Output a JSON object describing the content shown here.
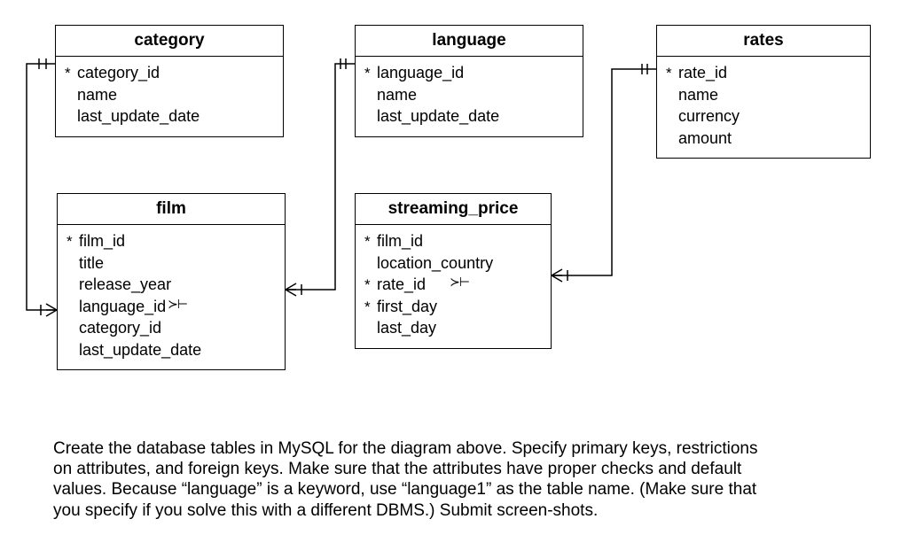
{
  "entities": {
    "category": {
      "title": "category",
      "attrs": [
        {
          "pk": true,
          "name": "category_id"
        },
        {
          "pk": false,
          "name": "name"
        },
        {
          "pk": false,
          "name": "last_update_date"
        }
      ]
    },
    "language": {
      "title": "language",
      "attrs": [
        {
          "pk": true,
          "name": "language_id"
        },
        {
          "pk": false,
          "name": "name"
        },
        {
          "pk": false,
          "name": "last_update_date"
        }
      ]
    },
    "rates": {
      "title": "rates",
      "attrs": [
        {
          "pk": true,
          "name": "rate_id"
        },
        {
          "pk": false,
          "name": "name"
        },
        {
          "pk": false,
          "name": "currency"
        },
        {
          "pk": false,
          "name": "amount"
        }
      ]
    },
    "film": {
      "title": "film",
      "attrs": [
        {
          "pk": true,
          "name": "film_id"
        },
        {
          "pk": false,
          "name": "title"
        },
        {
          "pk": false,
          "name": "release_year"
        },
        {
          "pk": false,
          "name": "language_id"
        },
        {
          "pk": false,
          "name": "category_id"
        },
        {
          "pk": false,
          "name": "last_update_date"
        }
      ]
    },
    "streaming_price": {
      "title": "streaming_price",
      "attrs": [
        {
          "pk": true,
          "name": "film_id"
        },
        {
          "pk": false,
          "name": "location_country"
        },
        {
          "pk": true,
          "name": "rate_id"
        },
        {
          "pk": true,
          "name": "first_day"
        },
        {
          "pk": false,
          "name": "last_day"
        }
      ]
    }
  },
  "fk_glyphs": {
    "film_language": "≻⊢",
    "film_category": "≻⊧",
    "sp_rate": "≻⊢",
    "cat_end_one": "⊣⊢",
    "lang_end_one": "⊣⊢",
    "rates_end_one": "⊣⊢"
  },
  "instructions": {
    "line1": "Create the database tables in MySQL for the diagram above.  Specify primary keys, restrictions",
    "line2": "on attributes, and foreign keys.  Make sure that the attributes have proper checks and default",
    "line3": "values.  Because “language” is a keyword, use “language1” as the table name.   (Make sure that",
    "line4": "you specify if you solve this with a different DBMS.)  Submit screen-shots."
  }
}
